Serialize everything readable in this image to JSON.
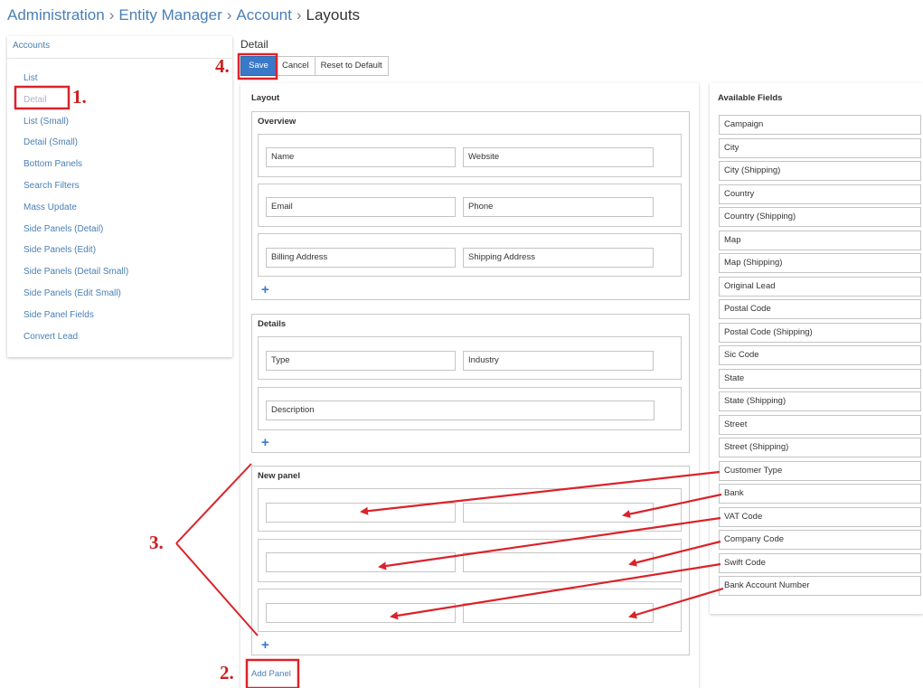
{
  "breadcrumb": {
    "items": [
      "Administration",
      "Entity Manager",
      "Account"
    ],
    "separator": "›",
    "current": "Layouts"
  },
  "sidebar": {
    "title": "Accounts",
    "items": [
      {
        "label": "List",
        "active": false
      },
      {
        "label": "Detail",
        "active": true
      },
      {
        "label": "List (Small)",
        "active": false
      },
      {
        "label": "Detail (Small)",
        "active": false
      },
      {
        "label": "Bottom Panels",
        "active": false
      },
      {
        "label": "Search Filters",
        "active": false
      },
      {
        "label": "Mass Update",
        "active": false
      },
      {
        "label": "Side Panels (Detail)",
        "active": false
      },
      {
        "label": "Side Panels (Edit)",
        "active": false
      },
      {
        "label": "Side Panels (Detail Small)",
        "active": false
      },
      {
        "label": "Side Panels (Edit Small)",
        "active": false
      },
      {
        "label": "Side Panel Fields",
        "active": false
      },
      {
        "label": "Convert Lead",
        "active": false
      }
    ]
  },
  "detail": {
    "title": "Detail",
    "save_label": "Save",
    "cancel_label": "Cancel",
    "reset_label": "Reset to Default"
  },
  "layout": {
    "heading": "Layout",
    "add_row_symbol": "+",
    "add_panel_label": "Add Panel",
    "panels": [
      {
        "label": "Overview",
        "rows": [
          [
            "Name",
            "Website"
          ],
          [
            "Email",
            "Phone"
          ],
          [
            "Billing Address",
            "Shipping Address"
          ]
        ]
      },
      {
        "label": "Details",
        "rows": [
          [
            "Type",
            "Industry"
          ],
          [
            "Description"
          ]
        ]
      },
      {
        "label": "New panel",
        "rows": [
          [
            "",
            ""
          ],
          [
            "",
            ""
          ],
          [
            "",
            ""
          ]
        ]
      }
    ]
  },
  "available_fields": {
    "heading": "Available Fields",
    "items": [
      "Campaign",
      "City",
      "City (Shipping)",
      "Country",
      "Country (Shipping)",
      "Map",
      "Map (Shipping)",
      "Original Lead",
      "Postal Code",
      "Postal Code (Shipping)",
      "Sic Code",
      "State",
      "State (Shipping)",
      "Street",
      "Street (Shipping)",
      "Customer Type",
      "Bank",
      "VAT Code",
      "Company Code",
      "Swift Code",
      "Bank Account Number"
    ]
  },
  "annotations": {
    "step_1": "1.",
    "step_2": "2.",
    "step_3": "3.",
    "step_4": "4.",
    "color": "#cc1f1f"
  },
  "colors": {
    "link": "#4a7fb5",
    "primary_button": "#3a79c8",
    "border": "#c4c4c4"
  }
}
